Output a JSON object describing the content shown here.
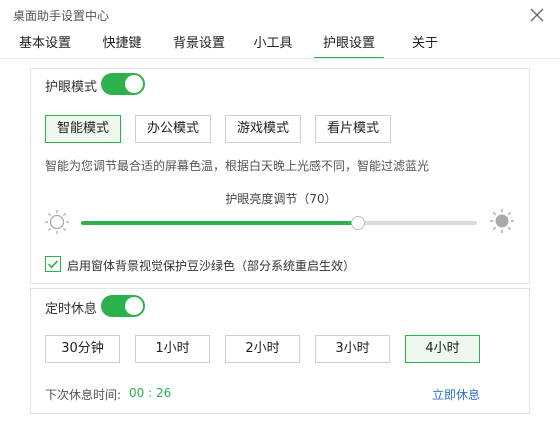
{
  "window": {
    "title": "桌面助手设置中心",
    "close_icon": "close-icon"
  },
  "tabs": [
    {
      "label": "基本设置",
      "active": false
    },
    {
      "label": "快捷键",
      "active": false
    },
    {
      "label": "背景设置",
      "active": false
    },
    {
      "label": "小工具",
      "active": false
    },
    {
      "label": "护眼设置",
      "active": true
    },
    {
      "label": "关于",
      "active": false
    }
  ],
  "eye_mode": {
    "label": "护眼模式",
    "enabled": true,
    "modes": [
      {
        "label": "智能模式",
        "selected": true
      },
      {
        "label": "办公模式",
        "selected": false
      },
      {
        "label": "游戏模式",
        "selected": false
      },
      {
        "label": "看片模式",
        "selected": false
      }
    ],
    "description": "智能为您调节最合适的屏幕色温，根据白天晚上光感不同，智能过滤蓝光",
    "brightness_label": "护眼亮度调节（70）",
    "brightness_value": 70,
    "checkbox_label": "启用窗体背景视觉保护豆沙绿色（部分系统重启生效）",
    "checkbox_checked": true
  },
  "timed_rest": {
    "label": "定时休息",
    "enabled": true,
    "options": [
      {
        "label": "30分钟",
        "selected": false
      },
      {
        "label": "1小时",
        "selected": false
      },
      {
        "label": "2小时",
        "selected": false
      },
      {
        "label": "3小时",
        "selected": false
      },
      {
        "label": "4小时",
        "selected": true
      }
    ],
    "next_rest_label": "下次休息时间:",
    "next_rest_time": "00 : 26",
    "rest_now_label": "立即休息"
  },
  "colors": {
    "accent": "#2bb24c",
    "link": "#2a74d6"
  }
}
